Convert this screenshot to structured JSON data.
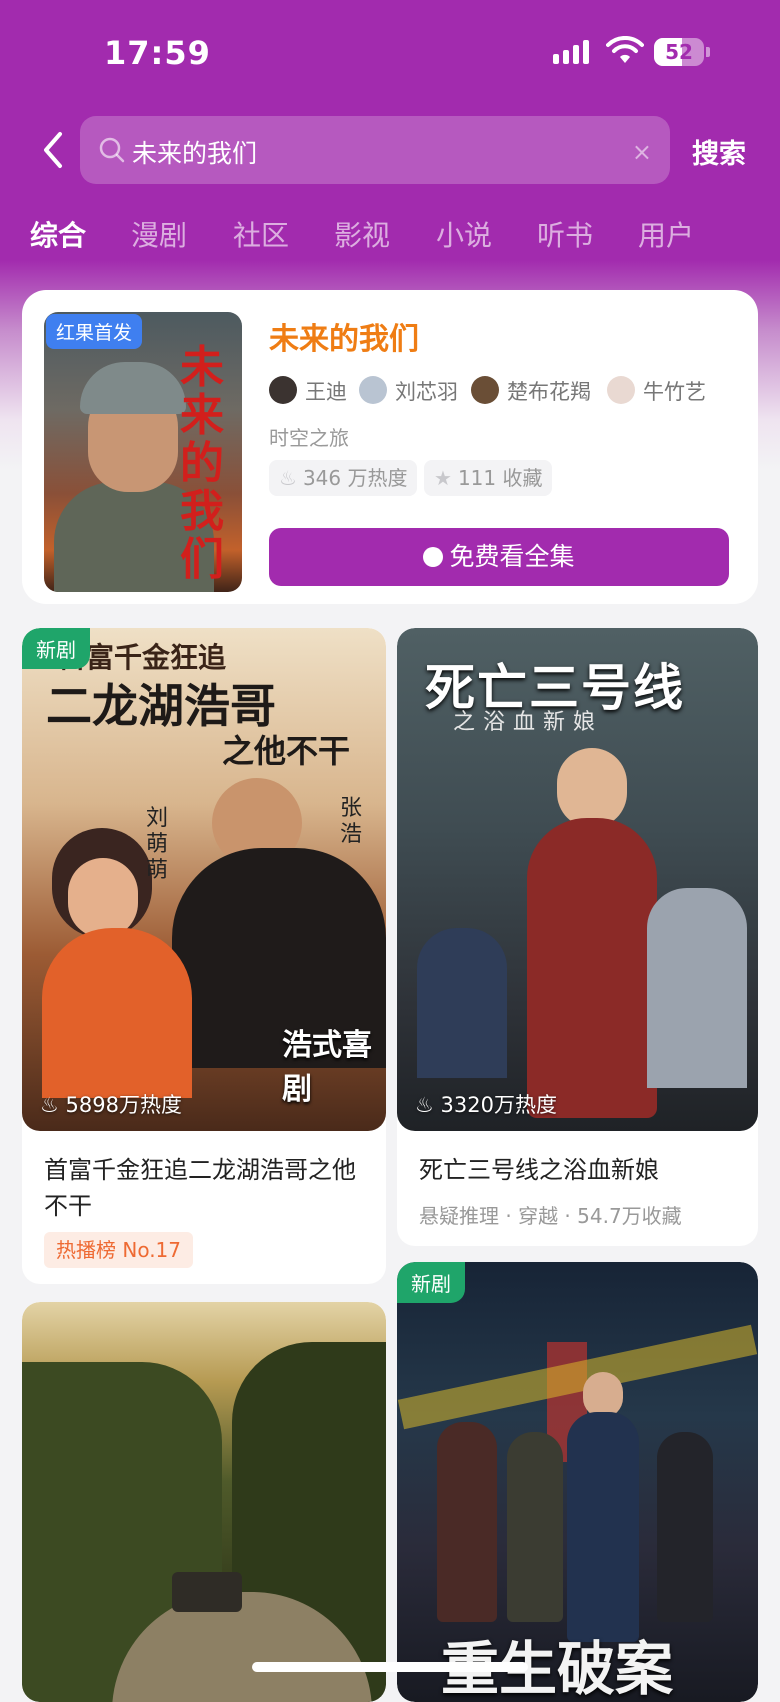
{
  "status": {
    "time": "17:59",
    "battery": "52"
  },
  "search": {
    "query": "未来的我们",
    "clear": "×",
    "button": "搜索"
  },
  "tabs": [
    "综合",
    "漫剧",
    "社区",
    "影视",
    "小说",
    "听书",
    "用户"
  ],
  "top_result": {
    "badge": "红果首发",
    "poster_text": "未来的我们",
    "title": "未来的我们",
    "cast": [
      "王迪",
      "刘芯羽",
      "楚布花羯",
      "牛竹艺"
    ],
    "genre": "时空之旅",
    "heat": "346 万热度",
    "favorites": "111 收藏",
    "watch_button": "免费看全集"
  },
  "cards": [
    {
      "tag": "新剧",
      "poster_headline": "二龙湖浩哥",
      "poster_sub": "之他不干",
      "poster_top": "首富千金狂追",
      "poster_names": [
        "刘萌萌",
        "张浩"
      ],
      "poster_corner": "浩式喜剧",
      "heat": "5898万热度",
      "title": "首富千金狂追二龙湖浩哥之他不干",
      "rank": "热播榜 No.17"
    },
    {
      "poster_headline": "死亡三号线",
      "poster_sub": "之浴血新娘",
      "heat": "3320万热度",
      "title": "死亡三号线之浴血新娘",
      "meta": "悬疑推理 · 穿越 · 54.7万收藏"
    },
    {},
    {
      "tag": "新剧",
      "poster_headline": "重生破案"
    }
  ],
  "colors": {
    "brand": "#a22bae",
    "accent": "#ef7d14",
    "new_tag": "#1fa56a"
  }
}
